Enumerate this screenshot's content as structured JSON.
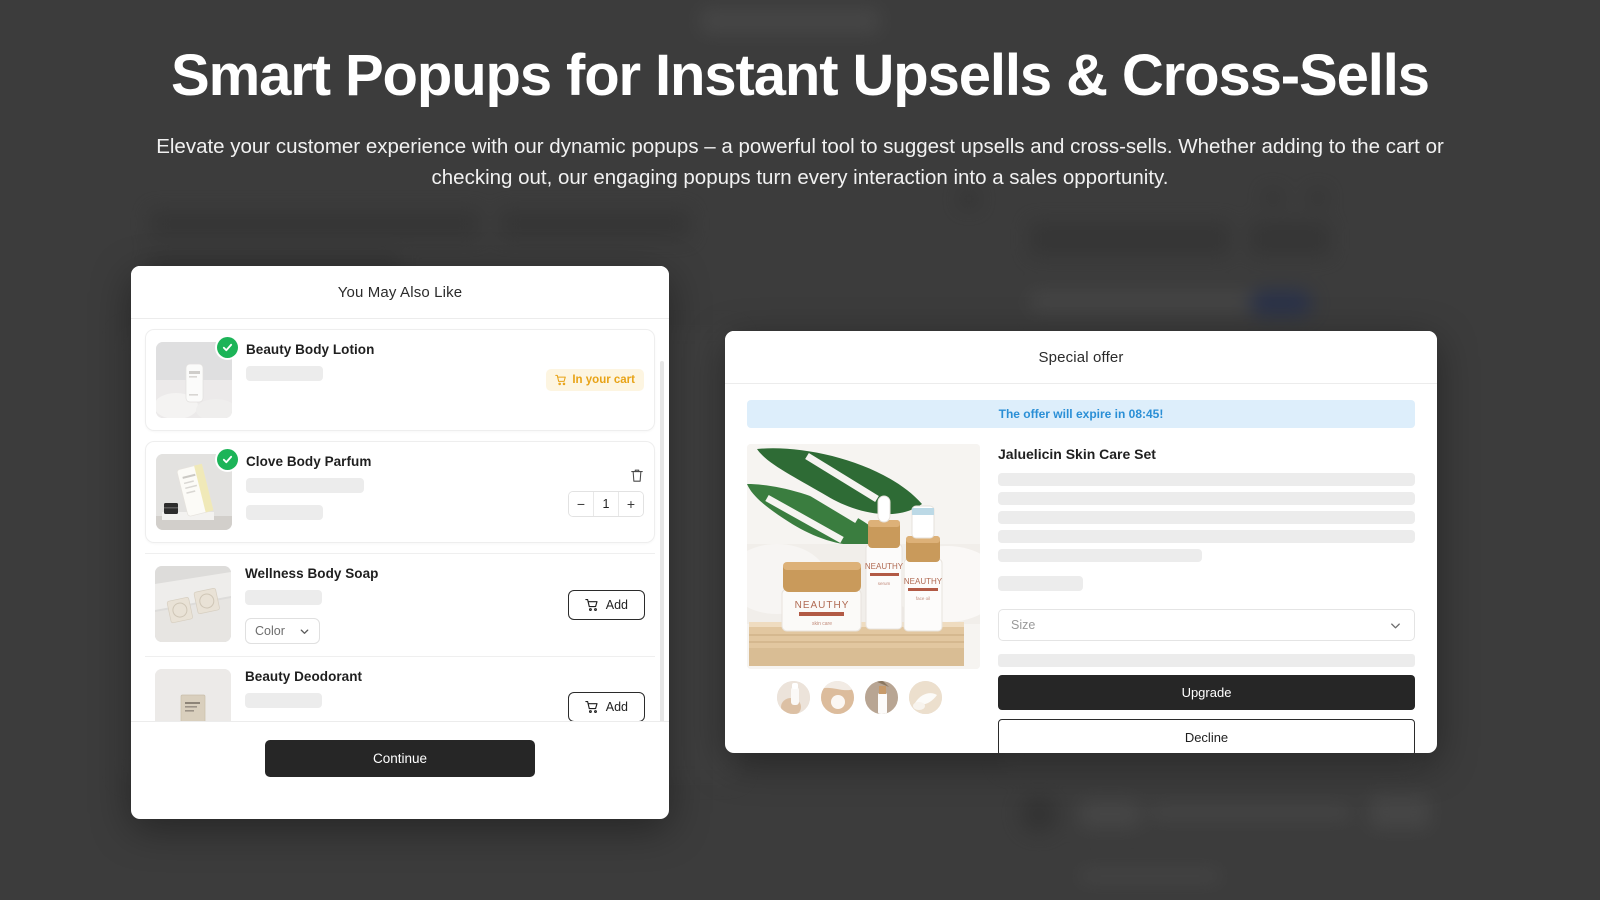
{
  "hero": {
    "headline": "Smart Popups for Instant Upsells & Cross-Sells",
    "subhead": "Elevate your customer experience with our dynamic popups – a powerful tool to suggest upsells and cross-sells. Whether adding to the cart or checking out, our engaging popups turn every interaction into a sales opportunity."
  },
  "colors": {
    "page_background": "#3c3c3c",
    "primary_button": "#262626",
    "in_cart_badge_bg": "#fdf5e1",
    "in_cart_badge_text": "#e8a317",
    "expire_banner_bg": "#ddeefb",
    "expire_banner_text": "#2a8fd6",
    "check_badge": "#1cb458",
    "skeleton": "#ececec"
  },
  "upsell_popup": {
    "title": "You May Also Like",
    "scrollbar": true,
    "products": [
      {
        "name": "Beauty Body Lotion",
        "in_cart": true,
        "has_check_badge": true,
        "badge_label": "In your cart",
        "badge_icon": "cart-icon",
        "image_alt": "beauty-body-lotion-thumbnail"
      },
      {
        "name": "Clove Body Parfum",
        "in_cart": true,
        "has_check_badge": true,
        "quantity": "1",
        "decrement_label": "−",
        "increment_label": "+",
        "delete_icon": "trash-icon",
        "image_alt": "clove-body-parfum-thumbnail"
      },
      {
        "name": "Wellness Body Soap",
        "in_cart": false,
        "has_check_badge": false,
        "variant_label": "Color",
        "variant_icon": "chevron-down-icon",
        "add_label": "Add",
        "add_icon": "cart-icon",
        "image_alt": "wellness-body-soap-thumbnail"
      },
      {
        "name": "Beauty Deodorant",
        "in_cart": false,
        "has_check_badge": false,
        "add_label": "Add",
        "add_icon": "cart-icon",
        "image_alt": "beauty-deodorant-thumbnail"
      }
    ],
    "footer": {
      "continue_label": "Continue"
    }
  },
  "offer_popup": {
    "title": "Special offer",
    "expire_notice": "The offer will expire in 08:45!",
    "product": {
      "name": "Jaluelicin Skin Care Set",
      "image_alt": "neauthy-skin-care-set-hero-image",
      "thumbnails": [
        "skin-care-thumbnail-1",
        "skin-care-thumbnail-2",
        "skin-care-thumbnail-3",
        "skin-care-thumbnail-4"
      ]
    },
    "size_select": {
      "placeholder": "Size",
      "icon": "chevron-down-icon"
    },
    "upgrade_label": "Upgrade",
    "decline_label": "Decline"
  }
}
